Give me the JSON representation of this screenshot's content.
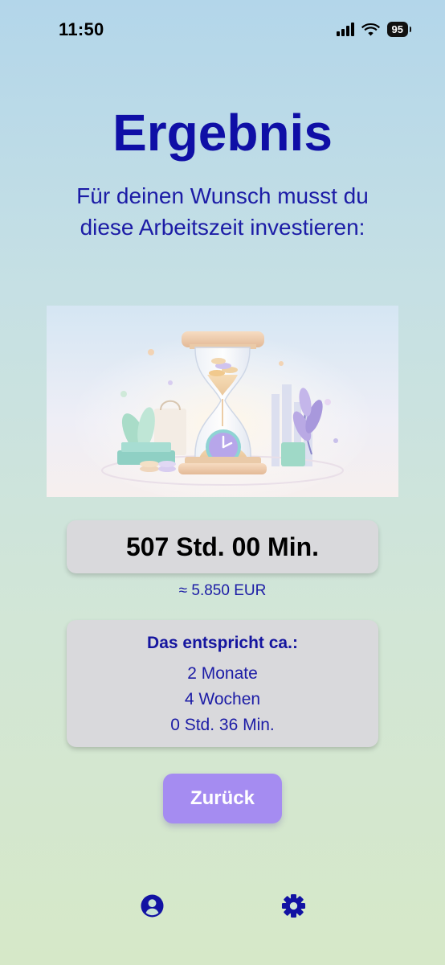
{
  "status_bar": {
    "time": "11:50",
    "battery": "95"
  },
  "page": {
    "title": "Ergebnis",
    "subtitle": "Für deinen Wunsch musst du diese Arbeitszeit investieren:"
  },
  "hero": {
    "icon": "hourglass-illustration"
  },
  "result": {
    "time_value": "507 Std. 00 Min.",
    "money_value": "≈ 5.850 EUR"
  },
  "equivalent": {
    "title": "Das entspricht ca.:",
    "items": [
      "2 Monate",
      "4 Wochen",
      "0 Std. 36 Min."
    ]
  },
  "actions": {
    "back_label": "Zurück"
  },
  "nav": {
    "profile_icon": "user-circle-icon",
    "settings_icon": "gear-icon"
  },
  "colors": {
    "accent": "#a58cf1",
    "text": "#1a1aa8",
    "title": "#0f0fa6",
    "card": "#d9d9dc"
  }
}
